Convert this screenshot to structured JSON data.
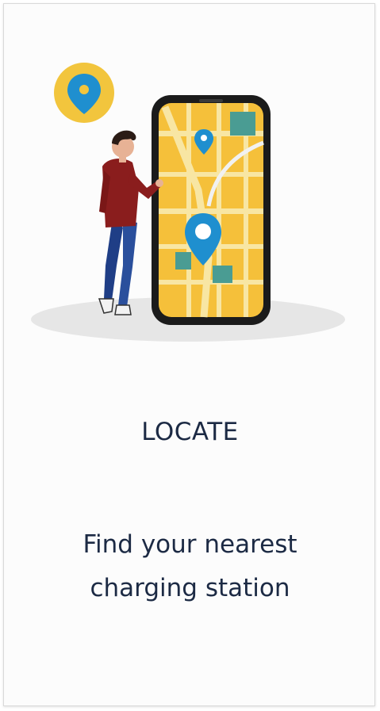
{
  "card": {
    "title": "LOCATE",
    "description_line1": "Find your nearest",
    "description_line2": "charging station"
  },
  "illustration": {
    "icons": [
      "location-pin-icon",
      "person-figure",
      "smartphone-map"
    ],
    "colors": {
      "map_yellow": "#f5c03a",
      "pin_blue": "#1f8fcf",
      "road_light": "#f8e6a3",
      "block_teal": "#4a9c93",
      "phone_frame": "#1b1b1b",
      "shirt_red": "#8a1d1d",
      "jeans_blue": "#2a4f9c",
      "shadow_grey": "#e6e6e6",
      "text_dark": "#1c2a44"
    }
  }
}
